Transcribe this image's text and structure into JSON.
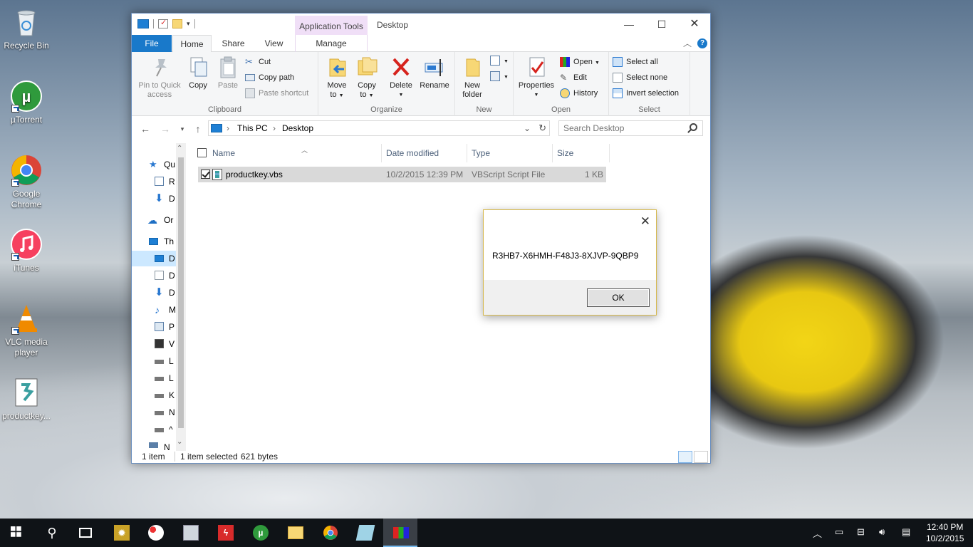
{
  "desktop": {
    "icons": [
      {
        "label": "Recycle Bin",
        "icon": "recycle-bin-icon"
      },
      {
        "label": "µTorrent",
        "icon": "utorrent-icon"
      },
      {
        "label": "Google Chrome",
        "icon": "chrome-icon"
      },
      {
        "label": "iTunes",
        "icon": "itunes-icon"
      },
      {
        "label": "VLC media player",
        "icon": "vlc-icon"
      },
      {
        "label": "productkey...",
        "icon": "vbs-file-icon"
      }
    ]
  },
  "explorer": {
    "title": "Desktop",
    "context_tab": "Application Tools",
    "tabs": {
      "file": "File",
      "home": "Home",
      "share": "Share",
      "view": "View",
      "manage": "Manage"
    },
    "ribbon": {
      "clipboard": {
        "label": "Clipboard",
        "pin": "Pin to Quick access",
        "pin_line1": "Pin to Quick",
        "pin_line2": "access",
        "copy": "Copy",
        "paste": "Paste",
        "cut": "Cut",
        "copy_path": "Copy path",
        "paste_shortcut": "Paste shortcut"
      },
      "organize": {
        "label": "Organize",
        "move_to_1": "Move",
        "move_to_2": "to",
        "copy_to_1": "Copy",
        "copy_to_2": "to",
        "delete": "Delete",
        "rename": "Rename"
      },
      "new": {
        "label": "New",
        "new_folder_1": "New",
        "new_folder_2": "folder"
      },
      "open": {
        "label": "Open",
        "properties": "Properties",
        "open": "Open",
        "edit": "Edit",
        "history": "History"
      },
      "select": {
        "label": "Select",
        "select_all": "Select all",
        "select_none": "Select none",
        "invert": "Invert selection"
      }
    },
    "address": {
      "crumb1": "This PC",
      "crumb2": "Desktop"
    },
    "search": {
      "placeholder": "Search Desktop"
    },
    "nav_pane": [
      {
        "label": "Qu",
        "icon": "star-icon"
      },
      {
        "label": "R",
        "icon": "recent-icon"
      },
      {
        "label": "D",
        "icon": "download-arrow-icon"
      },
      {
        "label": "Or",
        "icon": "onedrive-cloud-icon"
      },
      {
        "label": "Th",
        "icon": "this-pc-icon"
      },
      {
        "label": "D",
        "icon": "desktop-icon"
      },
      {
        "label": "D",
        "icon": "documents-icon"
      },
      {
        "label": "D",
        "icon": "download-arrow-icon"
      },
      {
        "label": "M",
        "icon": "music-icon"
      },
      {
        "label": "P",
        "icon": "pictures-icon"
      },
      {
        "label": "V",
        "icon": "videos-icon"
      },
      {
        "label": "L",
        "icon": "drive-icon"
      },
      {
        "label": "L",
        "icon": "drive-icon"
      },
      {
        "label": "K",
        "icon": "drive-icon"
      },
      {
        "label": "N",
        "icon": "drive-icon"
      },
      {
        "label": "^",
        "icon": "drive-icon"
      },
      {
        "label": "N",
        "icon": "network-icon"
      }
    ],
    "columns": {
      "name": "Name",
      "date": "Date modified",
      "type": "Type",
      "size": "Size"
    },
    "files": [
      {
        "name": "productkey.vbs",
        "date": "10/2/2015 12:39 PM",
        "type": "VBScript Script File",
        "size": "1 KB"
      }
    ],
    "status": {
      "count": "1 item",
      "selected": "1 item selected",
      "bytes": "621 bytes"
    }
  },
  "dialog": {
    "message": "R3HB7-X6HMH-F48J3-8XJVP-9QBP9",
    "ok": "OK"
  },
  "taskbar": {
    "time": "12:40 PM",
    "date": "10/2/2015"
  }
}
